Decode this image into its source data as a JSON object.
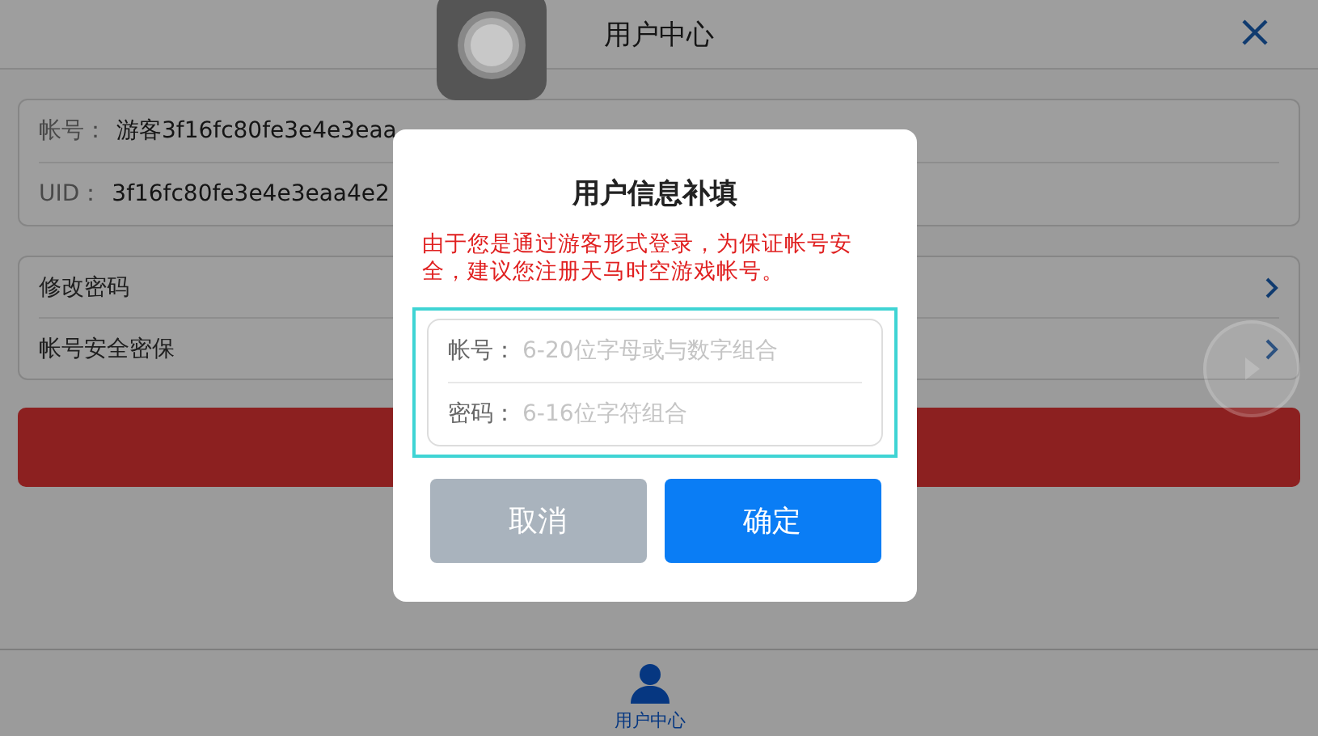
{
  "header": {
    "title": "用户中心"
  },
  "account_info": [
    {
      "label": "帐号：",
      "value": "游客3f16fc80fe3e4e3eaa"
    },
    {
      "label": "UID：",
      "value": "3f16fc80fe3e4e3eaa4e2"
    }
  ],
  "menu": [
    {
      "label": "修改密码"
    },
    {
      "label": "帐号安全密保"
    }
  ],
  "tab_bar": [
    {
      "label": "用户中心",
      "selected": true
    }
  ],
  "dialog": {
    "title": "用户信息补填",
    "notice": "由于您是通过游客形式登录，为保证帐号安全，建议您注册天马时空游戏帐号。",
    "fields": [
      {
        "label": "帐号：",
        "placeholder": "6-20位字母或与数字组合"
      },
      {
        "label": "密码：",
        "placeholder": "6-16位字符组合"
      }
    ],
    "buttons": [
      {
        "label": "取消",
        "kind": "secondary"
      },
      {
        "label": "确定",
        "kind": "primary"
      }
    ]
  }
}
